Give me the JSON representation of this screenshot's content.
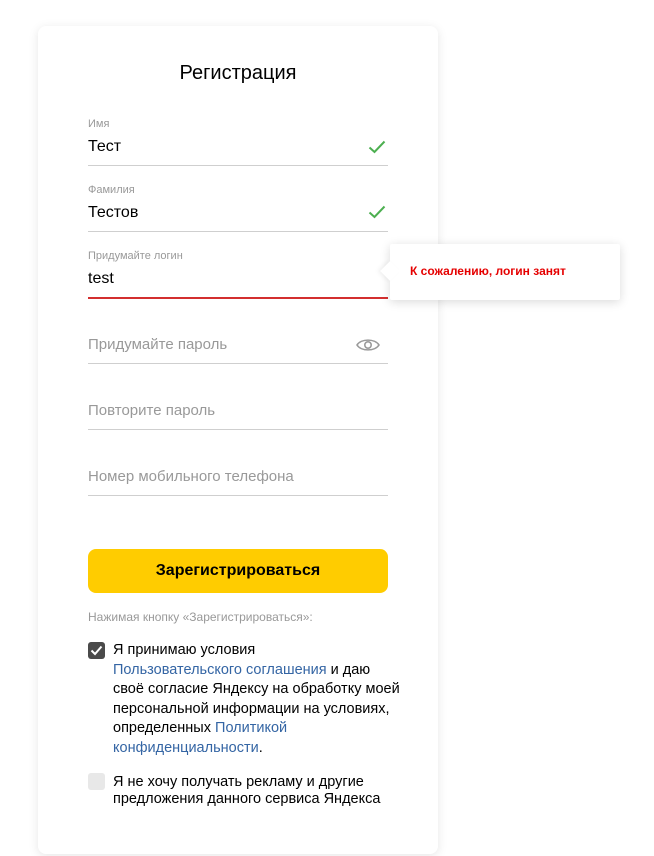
{
  "title": "Регистрация",
  "fields": {
    "first_name": {
      "label": "Имя",
      "value": "Тест",
      "valid": true
    },
    "last_name": {
      "label": "Фамилия",
      "value": "Тестов",
      "valid": true
    },
    "login": {
      "label": "Придумайте логин",
      "value": "test",
      "error": "К сожалению, логин занят"
    },
    "password": {
      "placeholder": "Придумайте пароль"
    },
    "password_repeat": {
      "placeholder": "Повторите пароль"
    },
    "phone": {
      "placeholder": "Номер мобильного телефона"
    }
  },
  "submit_label": "Зарегистрироваться",
  "hint": "Нажимая кнопку «Зарегистрироваться»:",
  "agreement": {
    "checked": true,
    "text_1": "Я принимаю условия",
    "link_1": "Пользовательского соглашения",
    "text_2": " и даю своё согласие Яндексу на обработку моей персональной информации на условиях, определенных ",
    "link_2": "Политикой конфиденциальности",
    "text_3": "."
  },
  "ads": {
    "checked": false,
    "text": "Я не хочу получать рекламу и другие предложения данного сервиса Яндекса"
  },
  "colors": {
    "accent": "#ffcc00",
    "error": "#e50000",
    "valid": "#4caf50",
    "link": "#3465a4"
  },
  "icons": {
    "valid": "check-icon",
    "password_toggle": "eye-icon"
  }
}
